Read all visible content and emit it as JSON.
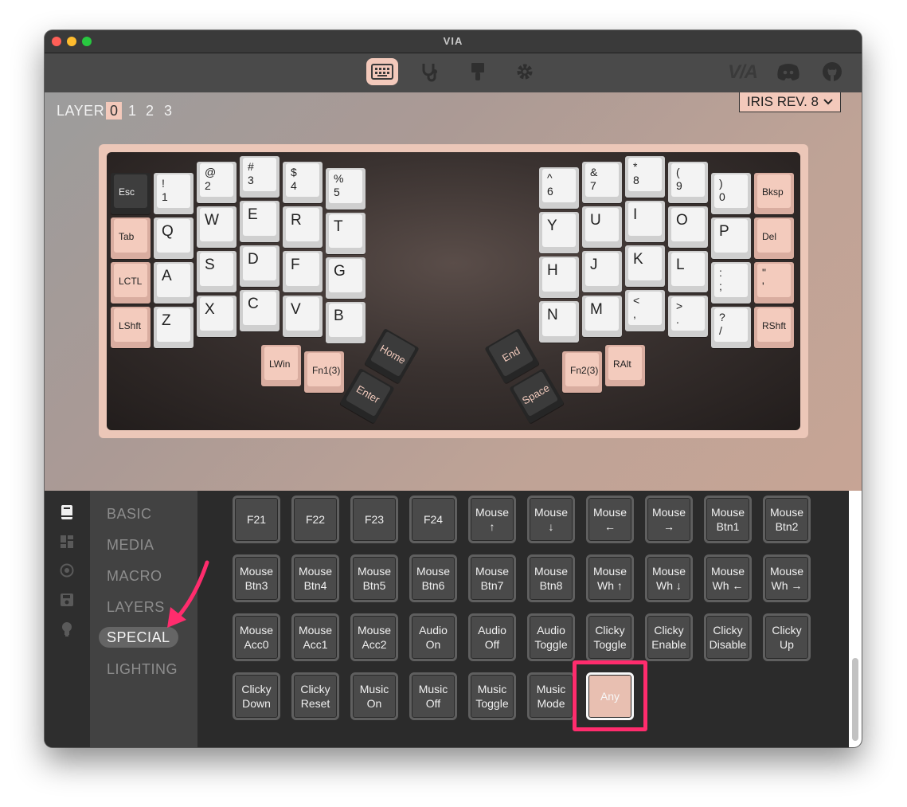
{
  "window": {
    "title": "VIA"
  },
  "nav": {
    "icons": [
      "keyboard-icon",
      "stethoscope-icon",
      "paint-brush-icon",
      "gear-icon"
    ],
    "brand": "V/A"
  },
  "layers": {
    "label": "LAYER",
    "items": [
      "0",
      "1",
      "2",
      "3"
    ],
    "active": "0"
  },
  "board": {
    "name": "IRIS REV. 8"
  },
  "keyboard": {
    "left": [
      [
        "Esc",
        "!\n1",
        "@\n2",
        "#\n3",
        "$\n4",
        "%\n5"
      ],
      [
        "Tab",
        "Q",
        "W",
        "E",
        "R",
        "T"
      ],
      [
        "LCTL",
        "A",
        "S",
        "D",
        "F",
        "G"
      ],
      [
        "LShft",
        "Z",
        "X",
        "C",
        "V",
        "B"
      ]
    ],
    "left_thumbs": [
      "LWin",
      "Fn1(3)",
      "Home",
      "Enter"
    ],
    "right": [
      [
        "^\n6",
        "&\n7",
        "*\n8",
        "(\n9",
        ")\n0",
        "Bksp"
      ],
      [
        "Y",
        "U",
        "I",
        "O",
        "P",
        "Del"
      ],
      [
        "H",
        "J",
        "K",
        "L",
        ":\n;",
        "\"\n'"
      ],
      [
        "N",
        "M",
        "<\n,",
        ">\n.",
        "?\n/",
        "RShft"
      ]
    ],
    "right_thumbs": [
      "End",
      "Space",
      "Fn2(3)",
      "RAlt"
    ]
  },
  "menu": {
    "rail_icons": [
      "book-icon",
      "layout-icon",
      "record-icon",
      "save-icon",
      "lightbulb-icon"
    ],
    "categories": [
      "BASIC",
      "MEDIA",
      "MACRO",
      "LAYERS",
      "SPECIAL",
      "LIGHTING"
    ],
    "active": "SPECIAL"
  },
  "special_keys": [
    "F21",
    "F22",
    "F23",
    "F24",
    "Mouse\n↑",
    "Mouse\n↓",
    "Mouse\n←",
    "Mouse\n→",
    "Mouse\nBtn1",
    "Mouse\nBtn2",
    "Mouse\nBtn3",
    "Mouse\nBtn4",
    "Mouse\nBtn5",
    "Mouse\nBtn6",
    "Mouse\nBtn7",
    "Mouse\nBtn8",
    "Mouse\nWh ↑",
    "Mouse\nWh ↓",
    "Mouse\nWh ←",
    "Mouse\nWh →",
    "Mouse\nAcc0",
    "Mouse\nAcc1",
    "Mouse\nAcc2",
    "Audio\nOn",
    "Audio\nOff",
    "Audio\nToggle",
    "Clicky\nToggle",
    "Clicky\nEnable",
    "Clicky\nDisable",
    "Clicky\nUp",
    "Clicky\nDown",
    "Clicky\nReset",
    "Music\nOn",
    "Music\nOff",
    "Music\nToggle",
    "Music\nMode",
    "Any"
  ],
  "selected_key": "Any",
  "colors": {
    "accent": "#f3c9bb",
    "highlight": "#ff2c6d",
    "arrow": "#ff2c6d"
  }
}
